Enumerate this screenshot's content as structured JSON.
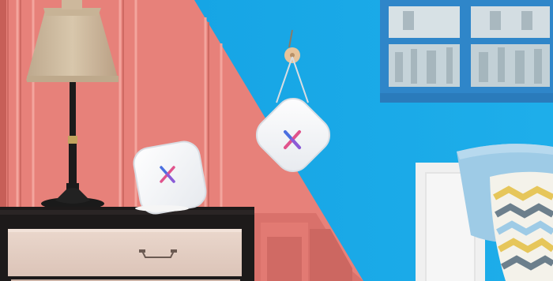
{
  "scene": {
    "description_icon": "x-logo-icon",
    "colors": {
      "coral_wall": "#e7817a",
      "coral_panel_line": "#f09a92",
      "coral_shadow": "#d46e67",
      "sky_wall": "#18a7e6",
      "sky_wall_light": "#3bb6ef",
      "window_frame": "#2f86c9",
      "window_glass": "#c9d6dc",
      "nightstand_top": "#1d1a1a",
      "drawer_front": "#e9d3c8",
      "lamp_shade": "#d2bfa5",
      "lamp_stem": "#1b1b1b",
      "lamp_base_gold": "#c2a25e",
      "router_white": "#f4f5f7",
      "router_edge": "#d9dde3",
      "logo_blue": "#4b6fe0",
      "logo_pink": "#e0538c",
      "logo_purple": "#8d5ad6",
      "pillow_blue": "#9ecbe6",
      "pillow_yellow": "#e6c65a",
      "pillow_gray": "#6c7f8c",
      "headboard": "#f2f2f2",
      "hook_wood": "#e7c39a"
    }
  }
}
